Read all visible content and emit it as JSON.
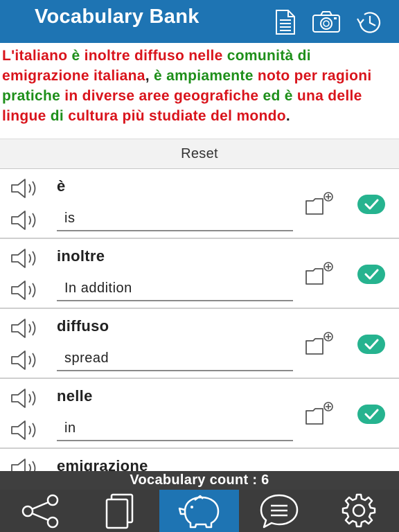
{
  "header": {
    "title": "Vocabulary Bank",
    "icons": [
      "document-icon",
      "camera-icon",
      "history-icon"
    ]
  },
  "passage": {
    "segments": [
      {
        "text": "L'",
        "color": "red"
      },
      {
        "text": "italiano",
        "color": "red"
      },
      {
        "text": " ",
        "color": "black"
      },
      {
        "text": "è",
        "color": "green"
      },
      {
        "text": " ",
        "color": "black"
      },
      {
        "text": "inoltre",
        "color": "red"
      },
      {
        "text": " ",
        "color": "black"
      },
      {
        "text": "diffuso",
        "color": "red"
      },
      {
        "text": " ",
        "color": "black"
      },
      {
        "text": "nelle",
        "color": "red"
      },
      {
        "text": " ",
        "color": "black"
      },
      {
        "text": "comunità",
        "color": "green"
      },
      {
        "text": " ",
        "color": "black"
      },
      {
        "text": "di",
        "color": "green"
      },
      {
        "text": " ",
        "color": "black"
      },
      {
        "text": "emigrazione",
        "color": "red"
      },
      {
        "text": " ",
        "color": "black"
      },
      {
        "text": "italiana",
        "color": "red"
      },
      {
        "text": ", ",
        "color": "black"
      },
      {
        "text": "è",
        "color": "green"
      },
      {
        "text": " ",
        "color": "black"
      },
      {
        "text": "ampiamente",
        "color": "green"
      },
      {
        "text": " ",
        "color": "black"
      },
      {
        "text": "noto",
        "color": "red"
      },
      {
        "text": " ",
        "color": "black"
      },
      {
        "text": "per",
        "color": "red"
      },
      {
        "text": " ",
        "color": "black"
      },
      {
        "text": "ragioni",
        "color": "red"
      },
      {
        "text": " ",
        "color": "black"
      },
      {
        "text": "pratiche",
        "color": "green"
      },
      {
        "text": " ",
        "color": "black"
      },
      {
        "text": "in",
        "color": "red"
      },
      {
        "text": " ",
        "color": "black"
      },
      {
        "text": "diverse",
        "color": "red"
      },
      {
        "text": " ",
        "color": "black"
      },
      {
        "text": "aree",
        "color": "red"
      },
      {
        "text": " ",
        "color": "black"
      },
      {
        "text": "geografiche",
        "color": "red"
      },
      {
        "text": " ",
        "color": "black"
      },
      {
        "text": "ed",
        "color": "green"
      },
      {
        "text": " ",
        "color": "black"
      },
      {
        "text": "è",
        "color": "green"
      },
      {
        "text": " ",
        "color": "black"
      },
      {
        "text": "una",
        "color": "red"
      },
      {
        "text": " ",
        "color": "black"
      },
      {
        "text": "delle",
        "color": "red"
      },
      {
        "text": " ",
        "color": "black"
      },
      {
        "text": "lingue",
        "color": "red"
      },
      {
        "text": " ",
        "color": "black"
      },
      {
        "text": "di",
        "color": "green"
      },
      {
        "text": " ",
        "color": "black"
      },
      {
        "text": "cultura",
        "color": "red"
      },
      {
        "text": " ",
        "color": "black"
      },
      {
        "text": "più",
        "color": "red"
      },
      {
        "text": " ",
        "color": "black"
      },
      {
        "text": "studiate",
        "color": "red"
      },
      {
        "text": " ",
        "color": "black"
      },
      {
        "text": "del",
        "color": "red"
      },
      {
        "text": " ",
        "color": "black"
      },
      {
        "text": "mondo",
        "color": "red"
      },
      {
        "text": ".",
        "color": "black"
      }
    ]
  },
  "reset_label": "Reset",
  "vocab": [
    {
      "word": "è",
      "translation": "is"
    },
    {
      "word": "inoltre",
      "translation": "In addition"
    },
    {
      "word": "diffuso",
      "translation": "spread"
    },
    {
      "word": "nelle",
      "translation": "in"
    },
    {
      "word": "emigrazione",
      "translation": ""
    }
  ],
  "count_label": "Vocabulary count : 6",
  "tabs": [
    {
      "icon": "share-icon",
      "active": false
    },
    {
      "icon": "cards-icon",
      "active": false
    },
    {
      "icon": "piggy-bank-icon",
      "active": true
    },
    {
      "icon": "chat-icon",
      "active": false
    },
    {
      "icon": "settings-icon",
      "active": false
    }
  ],
  "colors": {
    "header": "#1e74b3",
    "red_word": "#d9141c",
    "green_word": "#1e8f1a",
    "check": "#26b38f",
    "tabbar": "#3c3c3c",
    "active_tab": "#1e74b3"
  }
}
